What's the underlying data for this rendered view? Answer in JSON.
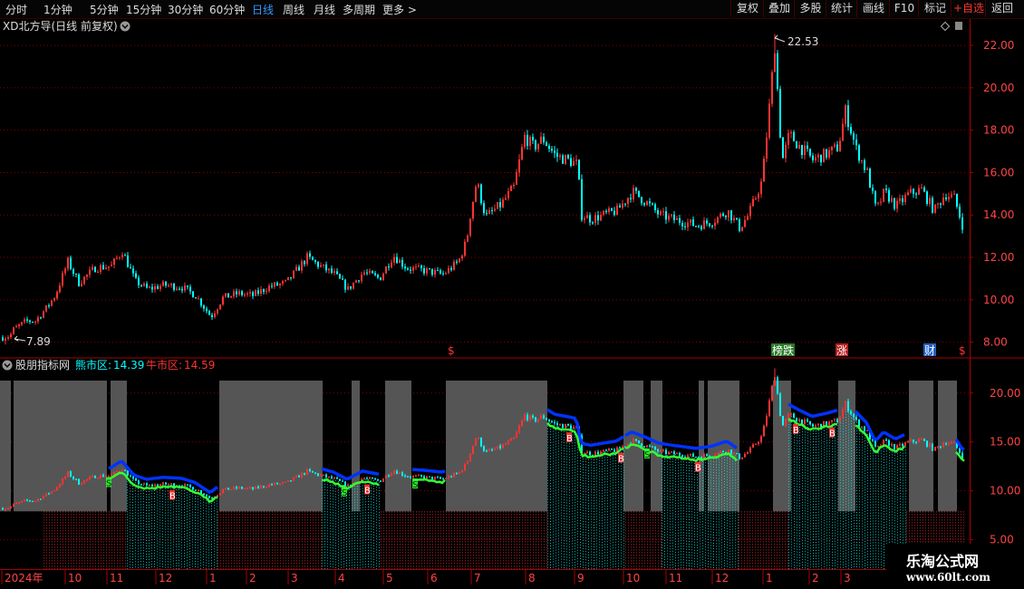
{
  "toolbar": {
    "periods": [
      "分时",
      "1分钟",
      "5分钟",
      "15分钟",
      "30分钟",
      "60分钟",
      "日线",
      "周线",
      "月线",
      "多周期",
      "更多 >"
    ],
    "active_period": "日线",
    "tools": [
      "复权",
      "叠加",
      "多股",
      "统计",
      "画线",
      "F10",
      "标记",
      "+自选",
      "返回"
    ]
  },
  "main_chart": {
    "stock_title": "XD北方导(日线 前复权)",
    "max_label": "22.53",
    "min_label": "7.89",
    "y_ticks": [
      "22.00",
      "20.00",
      "18.00",
      "16.00",
      "14.00",
      "12.00",
      "10.00",
      "8.00"
    ],
    "markers": [
      {
        "text": "$",
        "color": "#ff3333"
      },
      {
        "text": "榜跌",
        "color": "#ffffff",
        "bg": "#2a7a2a"
      },
      {
        "text": "涨",
        "color": "#ffffff",
        "bg": "#b02020"
      },
      {
        "text": "财",
        "color": "#ffffff",
        "bg": "#2060c0"
      },
      {
        "text": "$",
        "color": "#ff3333"
      }
    ]
  },
  "indicator": {
    "name": "股朋指标网",
    "bear_label": "熊市区:",
    "bear_value": "14.39",
    "bull_label": "牛市区:",
    "bull_value": "14.59",
    "y_ticks": [
      "20.00",
      "15.00",
      "10.00",
      "5.00"
    ]
  },
  "x_axis": {
    "labels": [
      "2024年",
      "10",
      "11",
      "12",
      "1",
      "2",
      "3",
      "4",
      "5",
      "6",
      "7",
      "8",
      "9",
      "10",
      "11",
      "12",
      "1",
      "2",
      "3"
    ]
  },
  "watermark": {
    "line1": "乐淘公式网",
    "line2": "www.60lt.com"
  },
  "colors": {
    "up": "#ff3333",
    "down": "#00ffff",
    "grid": "#880000",
    "bear_line": "#0033ff",
    "bull_line": "#33ff33",
    "zone": "#555555"
  },
  "chart_data": {
    "type": "candlestick",
    "close_anchors": [
      [
        0,
        8.2
      ],
      [
        10,
        8.3
      ],
      [
        14,
        8.6
      ],
      [
        28,
        9.0
      ],
      [
        38,
        9.0
      ],
      [
        50,
        9.6
      ],
      [
        60,
        10.2
      ],
      [
        74,
        11.8
      ],
      [
        86,
        10.8
      ],
      [
        104,
        11.5
      ],
      [
        122,
        11.6
      ],
      [
        134,
        12.3
      ],
      [
        148,
        10.9
      ],
      [
        162,
        10.5
      ],
      [
        180,
        10.7
      ],
      [
        200,
        10.6
      ],
      [
        215,
        10.2
      ],
      [
        232,
        9.2
      ],
      [
        245,
        10.1
      ],
      [
        262,
        10.3
      ],
      [
        278,
        10.2
      ],
      [
        295,
        10.6
      ],
      [
        315,
        10.8
      ],
      [
        338,
        12.0
      ],
      [
        352,
        11.6
      ],
      [
        368,
        11.2
      ],
      [
        383,
        10.5
      ],
      [
        400,
        11.3
      ],
      [
        418,
        11.0
      ],
      [
        433,
        12.1
      ],
      [
        448,
        11.5
      ],
      [
        465,
        11.4
      ],
      [
        488,
        11.2
      ],
      [
        505,
        11.8
      ],
      [
        514,
        12.8
      ],
      [
        518,
        14.0
      ],
      [
        525,
        15.6
      ],
      [
        535,
        13.9
      ],
      [
        552,
        14.5
      ],
      [
        566,
        15.3
      ],
      [
        578,
        17.7
      ],
      [
        588,
        17.2
      ],
      [
        598,
        17.6
      ],
      [
        612,
        16.8
      ],
      [
        625,
        16.6
      ],
      [
        636,
        16.4
      ],
      [
        641,
        14.0
      ],
      [
        652,
        13.8
      ],
      [
        665,
        14.0
      ],
      [
        680,
        14.2
      ],
      [
        697,
        15.1
      ],
      [
        712,
        14.6
      ],
      [
        727,
        14.0
      ],
      [
        742,
        13.8
      ],
      [
        760,
        13.6
      ],
      [
        768,
        13.5
      ],
      [
        785,
        13.7
      ],
      [
        802,
        14.2
      ],
      [
        815,
        13.4
      ],
      [
        825,
        14.0
      ],
      [
        840,
        15.6
      ],
      [
        847,
        18.6
      ],
      [
        854,
        22.0
      ],
      [
        862,
        16.5
      ],
      [
        870,
        17.8
      ],
      [
        880,
        17.3
      ],
      [
        896,
        16.6
      ],
      [
        912,
        16.9
      ],
      [
        924,
        17.2
      ],
      [
        932,
        18.9
      ],
      [
        944,
        17.1
      ],
      [
        956,
        16.0
      ],
      [
        966,
        14.2
      ],
      [
        975,
        15.1
      ],
      [
        988,
        14.4
      ],
      [
        1002,
        15.0
      ],
      [
        1016,
        15.2
      ],
      [
        1030,
        14.2
      ],
      [
        1042,
        15.0
      ],
      [
        1052,
        14.8
      ],
      [
        1062,
        13.4
      ]
    ],
    "high": 22.53,
    "low": 7.89,
    "y_range_main": [
      7.3,
      23.2
    ],
    "y_range_indicator": [
      2.0,
      23.5
    ],
    "bear_zones": [
      [
        0,
        12
      ],
      [
        15,
        118
      ],
      [
        122,
        140
      ],
      [
        242,
        356
      ],
      [
        388,
        397
      ],
      [
        425,
        454
      ],
      [
        492,
        604
      ],
      [
        688,
        710
      ],
      [
        718,
        731
      ],
      [
        771,
        777
      ],
      [
        781,
        816
      ],
      [
        853,
        873
      ],
      [
        925,
        944
      ],
      [
        1003,
        1030
      ],
      [
        1035,
        1056
      ]
    ],
    "bar_segments": [
      {
        "from": 48,
        "to": 140,
        "color": "up"
      },
      {
        "from": 140,
        "to": 240,
        "color": "down"
      },
      {
        "from": 240,
        "to": 355,
        "color": "up"
      },
      {
        "from": 355,
        "to": 420,
        "color": "down"
      },
      {
        "from": 420,
        "to": 492,
        "color": "up"
      },
      {
        "from": 492,
        "to": 604,
        "color": "up"
      },
      {
        "from": 604,
        "to": 690,
        "color": "down"
      },
      {
        "from": 690,
        "to": 730,
        "color": "up"
      },
      {
        "from": 730,
        "to": 815,
        "color": "down"
      },
      {
        "from": 815,
        "to": 870,
        "color": "up"
      },
      {
        "from": 870,
        "to": 1000,
        "color": "down"
      },
      {
        "from": 1000,
        "to": 1065,
        "color": "up"
      }
    ],
    "band_segments": [
      [
        120,
        240
      ],
      [
        355,
        420
      ],
      [
        455,
        492
      ],
      [
        604,
        688
      ],
      [
        690,
        815
      ],
      [
        870,
        925
      ],
      [
        944,
        1000
      ],
      [
        1055,
        1065
      ]
    ],
    "signal_points": [
      {
        "x": 120,
        "label": "S"
      },
      {
        "x": 190,
        "label": "B"
      },
      {
        "x": 380,
        "label": "S"
      },
      {
        "x": 405,
        "label": "B"
      },
      {
        "x": 458,
        "label": "S"
      },
      {
        "x": 628,
        "label": "B"
      },
      {
        "x": 685,
        "label": "B"
      },
      {
        "x": 714,
        "label": "S"
      },
      {
        "x": 770,
        "label": "B"
      },
      {
        "x": 878,
        "label": "B"
      },
      {
        "x": 918,
        "label": "B"
      }
    ]
  }
}
